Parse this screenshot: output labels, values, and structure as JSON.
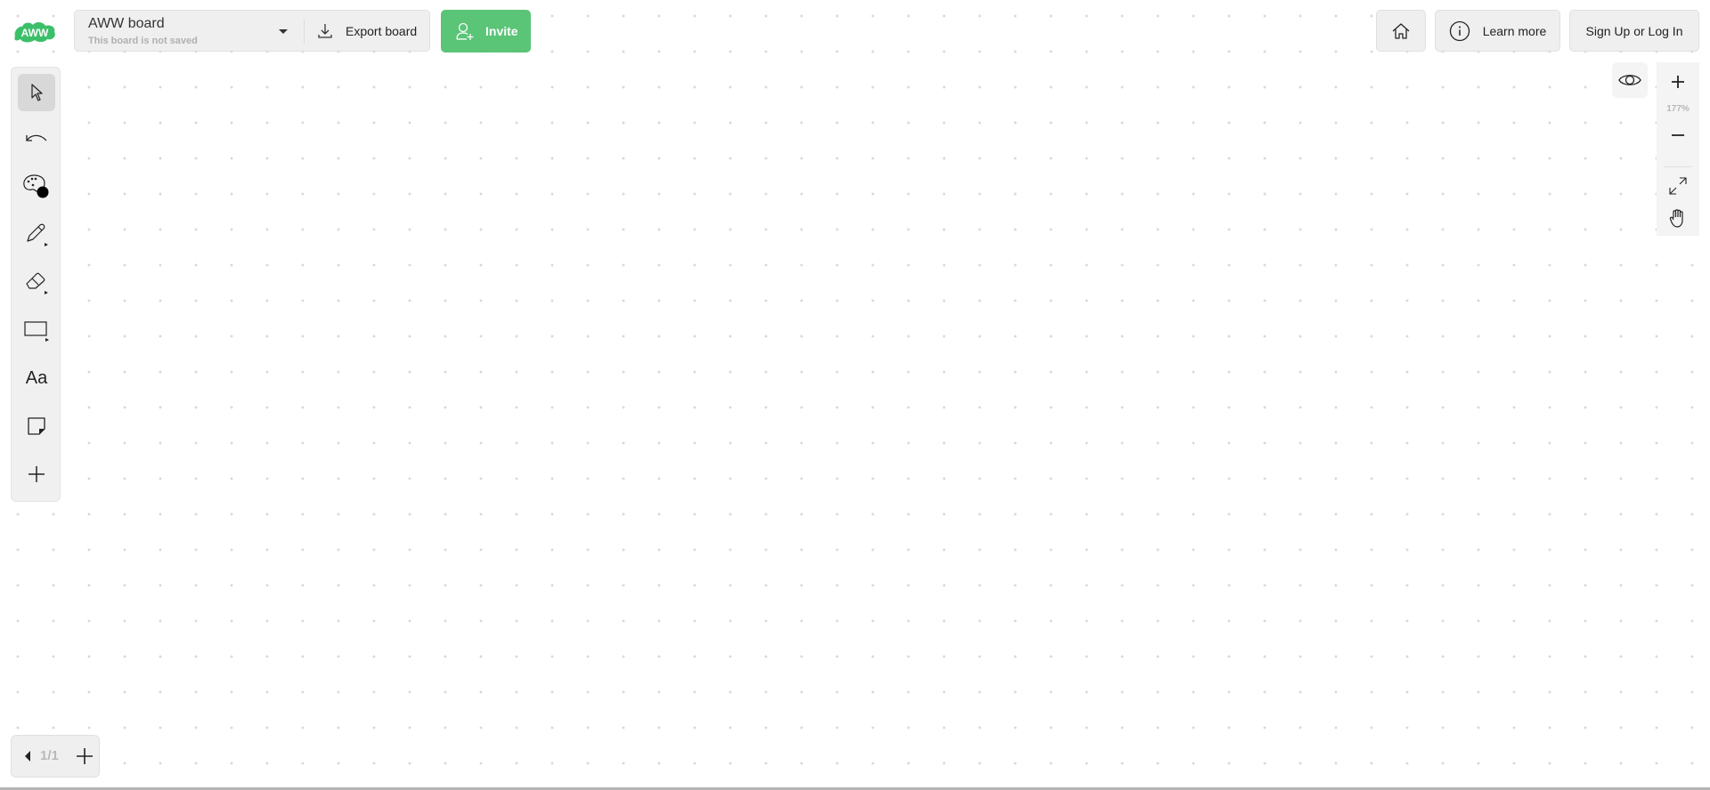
{
  "app": {
    "logo_text": "AWW",
    "brand_color": "#5ac477"
  },
  "board": {
    "name": "AWW board",
    "status": "This board is not saved",
    "export_label": "Export board",
    "invite_label": "Invite"
  },
  "top_right": {
    "home_icon": "home-icon",
    "learn_more_label": "Learn more",
    "signup_label": "Sign Up or Log In"
  },
  "toolbar": {
    "tools": [
      {
        "id": "select",
        "icon": "cursor-icon",
        "active": true
      },
      {
        "id": "undo",
        "icon": "undo-icon"
      },
      {
        "id": "color",
        "icon": "palette-icon",
        "current_color": "#000000"
      },
      {
        "id": "pen",
        "icon": "pencil-icon",
        "has_submenu": true
      },
      {
        "id": "eraser",
        "icon": "eraser-icon",
        "has_submenu": true
      },
      {
        "id": "shape",
        "icon": "rectangle-icon",
        "has_submenu": true
      },
      {
        "id": "text",
        "icon": "text-icon",
        "label": "Aa"
      },
      {
        "id": "sticky",
        "icon": "sticky-note-icon"
      },
      {
        "id": "more",
        "icon": "plus-icon"
      }
    ]
  },
  "view": {
    "zoom_level": "177%",
    "eye_icon": "eye-icon"
  },
  "pages": {
    "current": "1/1"
  }
}
